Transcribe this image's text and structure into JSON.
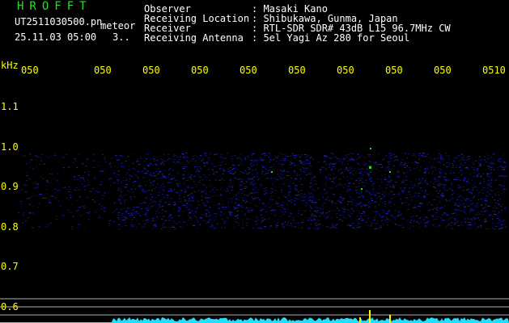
{
  "app": {
    "logo": "HROFFT",
    "filename": "UT2511030500.pn",
    "mode_label": "meteor",
    "datetime": "25.11.03 05:00",
    "counter": "3..",
    "header": [
      {
        "label": "Observer",
        "value": ": Masaki Kano"
      },
      {
        "label": "Receiving Location",
        "value": ": Shibukawa, Gunma, Japan"
      },
      {
        "label": "Receiver",
        "value": ": RTL-SDR SDR# 43dB L15 96.7MHz CW"
      },
      {
        "label": "Receiving Antenna",
        "value": ": 5el Yagi Az 280 for Seoul"
      }
    ]
  },
  "axes": {
    "freq_unit": "kHz",
    "time_ticks": [
      "050",
      "050",
      "050",
      "050",
      "050",
      "050",
      "050",
      "050",
      "050",
      "0510"
    ],
    "freq_ticks": [
      {
        "label": "1.1",
        "value": 1.1
      },
      {
        "label": "1.0",
        "value": 1.0
      },
      {
        "label": "0.9",
        "value": 0.9
      },
      {
        "label": "0.8",
        "value": 0.8
      },
      {
        "label": "0.7",
        "value": 0.7
      },
      {
        "label": "0.6",
        "value": 0.6
      }
    ],
    "freq_range": [
      0.55,
      1.16
    ]
  },
  "colors": {
    "background": "#000000",
    "logo": "#28e028",
    "header_text": "#ffffff",
    "axis_text": "#ffff00",
    "grid": "#b0b0b0",
    "echo": "#2a2aff",
    "noise_floor": "#20e0ff"
  }
}
